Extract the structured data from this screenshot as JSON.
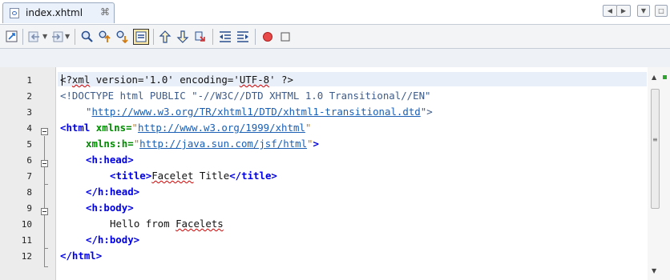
{
  "tab": {
    "label": "index.xhtml",
    "close": "⌘"
  },
  "lines": [
    "1",
    "2",
    "3",
    "4",
    "5",
    "6",
    "7",
    "8",
    "9",
    "10",
    "11",
    "12"
  ],
  "code": {
    "l1": {
      "open": "<?",
      "xml": "xml",
      "rest": " version='1.0' encoding='",
      "utf": "UTF-8",
      "end": "' ?>"
    },
    "l2": {
      "text": "<!DOCTYPE html PUBLIC \"-//W3C//DTD XHTML 1.0 Transitional//EN\""
    },
    "l3": {
      "q1": "\"",
      "url": "http://www.w3.org/TR/xhtml1/DTD/xhtml1-transitional.dtd",
      "q2": "\">"
    },
    "l4": {
      "tag": "<html",
      "attr": " xmlns=",
      "q1": "\"",
      "url": "http://www.w3.org/1999/xhtml",
      "q2": "\""
    },
    "l5": {
      "attr": "xmlns:h=",
      "q1": "\"",
      "url": "http://java.sun.com/jsf/html",
      "q2": "\"",
      "end": ">"
    },
    "l6": {
      "tag": "<h:head>"
    },
    "l7": {
      "open": "<title>",
      "word": "Facelet",
      "rest": " Title",
      "close": "</title>"
    },
    "l8": {
      "tag": "</h:head>"
    },
    "l9": {
      "tag": "<h:body>"
    },
    "l10": {
      "text": "Hello from ",
      "word": "Facelets"
    },
    "l11": {
      "tag": "</h:body>"
    },
    "l12": {
      "tag": "</html>"
    }
  },
  "icons": {
    "toolbar": [
      "history-icon",
      "back-icon",
      "forward-icon",
      "find-icon",
      "find-previous-icon",
      "find-next-icon",
      "toggle-highlight-icon",
      "previous-bookmark-icon",
      "next-bookmark-icon",
      "toggle-bookmark-icon",
      "shift-left-icon",
      "shift-right-icon",
      "start-macro-icon",
      "stop-macro-icon"
    ]
  },
  "colors": {
    "tag": "#0000e6",
    "attr": "#008c00",
    "value": "#ce7b00",
    "url": "#1a5fb4",
    "current_line": "#e9eff8"
  }
}
